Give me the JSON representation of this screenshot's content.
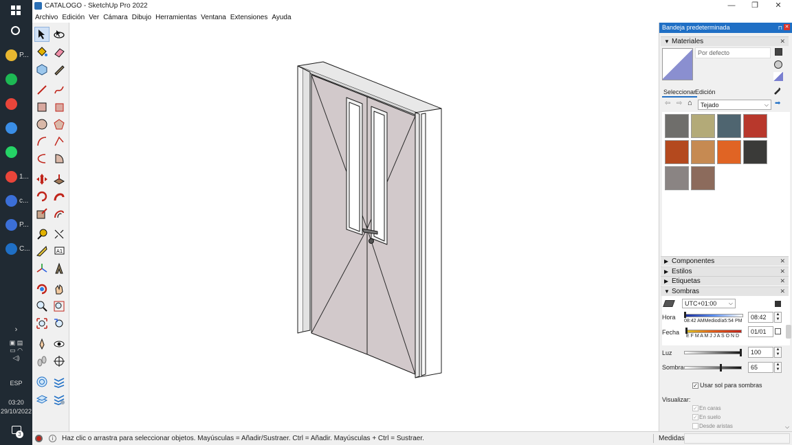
{
  "window": {
    "title": "CATALOGO - SketchUp Pro 2022",
    "minimize": "—",
    "restore": "❐",
    "close": "✕"
  },
  "menu": [
    "Archivo",
    "Edición",
    "Ver",
    "Cámara",
    "Dibujo",
    "Herramientas",
    "Ventana",
    "Extensiones",
    "Ayuda"
  ],
  "taskbar": {
    "apps": [
      {
        "label": "P...",
        "color": "#e8b730",
        "icon": "folder-icon"
      },
      {
        "label": "",
        "color": "#1db954",
        "icon": "spotify-icon"
      },
      {
        "label": "",
        "color": "#e9453a",
        "icon": "chrome-icon"
      },
      {
        "label": "",
        "color": "#3a8ee6",
        "icon": "chrome-profile-icon"
      },
      {
        "label": "",
        "color": "#25d366",
        "icon": "whatsapp-icon"
      },
      {
        "label": "1...",
        "color": "#e9453a",
        "icon": "chrome-icon"
      },
      {
        "label": "c...",
        "color": "#3b6fd8",
        "icon": "edge-icon"
      },
      {
        "label": "P...",
        "color": "#3b6fd8",
        "icon": "edge-icon"
      },
      {
        "label": "C...",
        "color": "#1f6fc5",
        "icon": "sketchup-icon"
      }
    ],
    "language": "ESP",
    "time": "03:20",
    "date": "29/10/2022",
    "notification_count": "3"
  },
  "status": {
    "hint": "Haz clic o arrastra para seleccionar objetos. Mayúsculas = Añadir/Sustraer. Ctrl = Añadir. Mayúsculas + Ctrl = Sustraer.",
    "measures_label": "Medidas"
  },
  "tray": {
    "title": "Bandeja predeterminada",
    "materials": {
      "header": "Materiales",
      "current": "Por defecto",
      "tab_select": "Seleccionar",
      "tab_edit": "Edición",
      "library": "Tejado",
      "swatch_colors": [
        "#6f6e6b",
        "#b3aa78",
        "#4f6570",
        "#b8382c",
        "#b4491e",
        "#c68a52",
        "#e06424",
        "#3a3a38",
        "#8a8483",
        "#8c6b5c"
      ]
    },
    "sections": [
      "Componentes",
      "Estilos",
      "Etiquetas",
      "Sombras"
    ],
    "shadows": {
      "timezone": "UTC+01:00",
      "time_label": "Hora",
      "time_scale": "08:42 AMMediodía5:54 PM",
      "time_value": "08:42",
      "date_label": "Fecha",
      "month_scale": "E F M A M J J A S O N D",
      "date_value": "01/01",
      "light_label": "Luz",
      "light_value": "100",
      "light_level": 1.0,
      "shadow_label": "Sombra",
      "shadow_value": "65",
      "shadow_level": 0.65,
      "use_sun_label": "Usar sol para sombras",
      "display_label": "Visualizar:",
      "on_faces": "En caras",
      "on_ground": "En suelo",
      "from_edges": "Desde aristas"
    }
  }
}
